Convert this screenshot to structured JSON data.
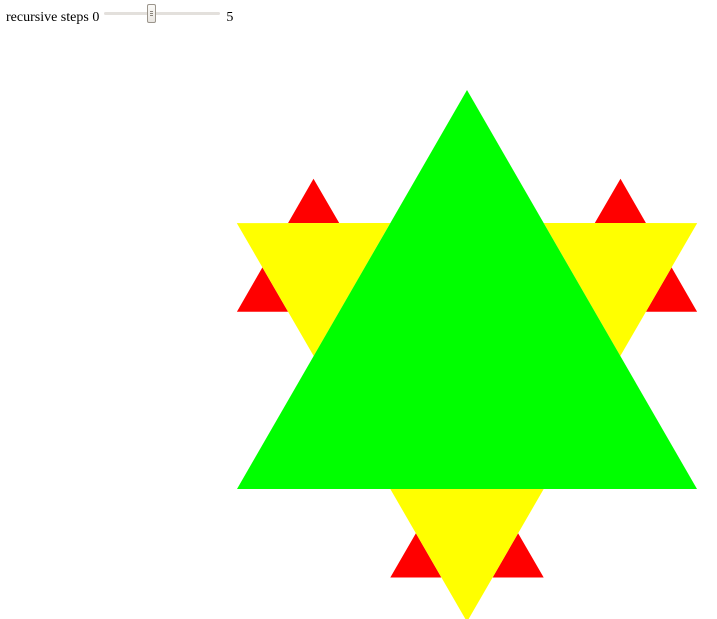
{
  "controls": {
    "label": "recursive steps",
    "min_label": "0",
    "max_label": "5"
  },
  "slider": {
    "min": 0,
    "max": 5,
    "value": 2
  },
  "colors": {
    "level_0": "#00ff00",
    "level_1": "#ffff00",
    "level_2": "#ff0000",
    "background": "#ffffff"
  }
}
